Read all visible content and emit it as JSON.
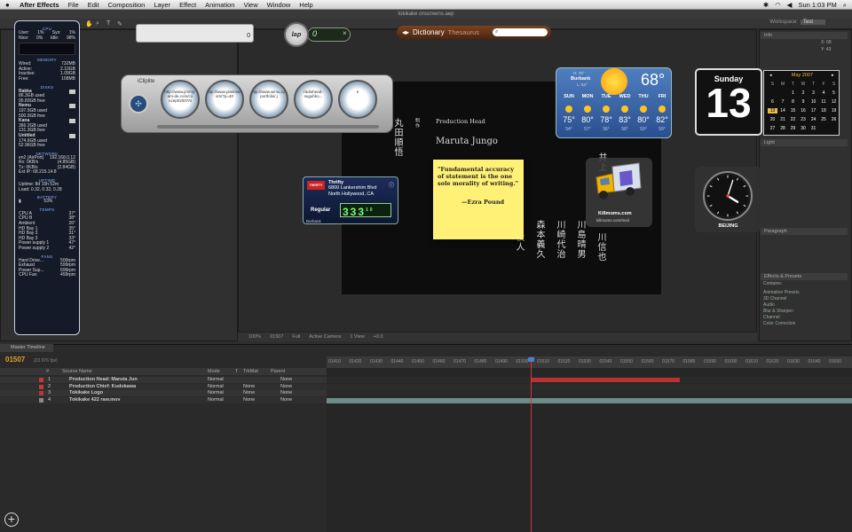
{
  "menubar": {
    "app": "After Effects",
    "items": [
      "File",
      "Edit",
      "Composition",
      "Layer",
      "Effect",
      "Animation",
      "View",
      "Window",
      "Help"
    ],
    "clock": "Sun 1:03 PM"
  },
  "window_title": "tokikake onscreens.aep",
  "workspace": {
    "label": "Workspace:",
    "value": "Test"
  },
  "istat": {
    "cpu_title": "CPU",
    "cpu": [
      [
        "User:",
        "1%",
        "Sys:",
        "1%"
      ],
      [
        "Nice:",
        "0%",
        "Idle:",
        "98%"
      ]
    ],
    "memory_title": "MEMORY",
    "memory": [
      [
        "Wired:",
        "732MB"
      ],
      [
        "Active:",
        "2.10GB"
      ],
      [
        "Inactive:",
        "1.09GB"
      ],
      [
        "Free:",
        "108MB"
      ]
    ],
    "disks_title": "DISKS",
    "disks": [
      {
        "name": "Rakka",
        "used": "86.3GB used",
        "free": "95.83GB free"
      },
      {
        "name": "Nemu",
        "used": "197.5GB used",
        "free": "500.9GB free"
      },
      {
        "name": "Kana",
        "used": "366.2GB used",
        "free": "131.3GB free"
      },
      {
        "name": "Untitled",
        "used": "174.6GB used",
        "free": "52.96GB free"
      }
    ],
    "network_title": "NETWORK",
    "network": [
      [
        "en2 (AirPort)",
        "192.168.0.12"
      ],
      [
        "Rx: 0KB/s",
        "(4.85GB)"
      ],
      [
        "Tx: 0KB/s",
        "(2.84GB)"
      ],
      [
        "Ext IP: 68.215.14.8",
        ""
      ]
    ],
    "uptime_title": "UPTIME",
    "uptime": "Uptime: 8d 15h 52m",
    "load": "Load: 0.32, 0.32, 0.28",
    "battery_title": "BATTERY",
    "battery": "53%",
    "temps_title": "TEMPS",
    "temps": [
      [
        "CPU A",
        "37°"
      ],
      [
        "CPU B",
        "38°"
      ],
      [
        "Ambient",
        "26°"
      ],
      [
        "HD Bay 1",
        "35°"
      ],
      [
        "HD Bay 3",
        "31°"
      ],
      [
        "HD Bay 3",
        "33°"
      ],
      [
        "Power supply 1",
        "47°"
      ],
      [
        "Power supply 2",
        "42°"
      ]
    ],
    "fans_title": "FANS",
    "fans": [
      [
        "Hard Drive...",
        "500rpm"
      ],
      [
        "Exhaust",
        "599rpm"
      ],
      [
        "Power Sup...",
        "699rpm"
      ],
      [
        "CPU Fan",
        "499rpm"
      ]
    ]
  },
  "search_widget": {
    "value": "0"
  },
  "lap_widget": {
    "label": "lap",
    "value": "0"
  },
  "dictionary": {
    "tab1": "Dictionary",
    "tab2": "Thesaurus",
    "placeholder": ""
  },
  "icliplite": {
    "title": "iCliplite",
    "clips": [
      "http://www.jimmy-am-de.com/co ncept/2007/0",
      "http://www.plasmamo.c om/?p=40",
      "http://www.wimu.com/s portfolio/.j",
      "radiohead-suguhko...",
      "e"
    ]
  },
  "thrifty": {
    "logo": "THRIFTY",
    "name": "Thrifty",
    "street": "6800 Lankershim Blvd",
    "city_state": "North Hollywood, CA",
    "grade": "Regular",
    "price": "333",
    "tenth": "10",
    "town": "Burbank"
  },
  "sticky": {
    "quote": "\"Fundamental accuracy of statement is the one sole morality of writing.\"",
    "author": "—Ezra Pound"
  },
  "killmoms": {
    "name": "Killmoms.com",
    "url": "killmoms.com/mail"
  },
  "weather": {
    "hilo": "H: 75°",
    "city": "Burbank",
    "lo": "L: 54°",
    "temp": "68°",
    "days": [
      {
        "d": "SUN",
        "hi": "75°",
        "lo": "54°"
      },
      {
        "d": "MON",
        "hi": "80°",
        "lo": "57°"
      },
      {
        "d": "TUE",
        "hi": "78°",
        "lo": "56°"
      },
      {
        "d": "WED",
        "hi": "83°",
        "lo": "58°"
      },
      {
        "d": "THU",
        "hi": "80°",
        "lo": "59°"
      },
      {
        "d": "FRI",
        "hi": "82°",
        "lo": "59°"
      }
    ]
  },
  "calendar": {
    "weekday": "Sunday",
    "date": "13"
  },
  "month_cal": {
    "title": "May 2007",
    "headers": [
      "S",
      "M",
      "T",
      "W",
      "T",
      "F",
      "S"
    ],
    "weeks": [
      [
        "",
        "",
        "1",
        "2",
        "3",
        "4",
        "5"
      ],
      [
        "6",
        "7",
        "8",
        "9",
        "10",
        "11",
        "12"
      ],
      [
        "13",
        "14",
        "15",
        "16",
        "17",
        "18",
        "19"
      ],
      [
        "20",
        "21",
        "22",
        "23",
        "24",
        "25",
        "26"
      ],
      [
        "27",
        "28",
        "29",
        "30",
        "31",
        "",
        ""
      ]
    ],
    "today": "13"
  },
  "clock": {
    "city": "BEIJING",
    "hours": "4",
    "minutes": "3"
  },
  "comp": {
    "production_head": "Production Head",
    "name": "Maruta Jungo",
    "vert_small": "制作",
    "vert_name": "丸田順悟",
    "col1": "森本義久",
    "col2": "川崎代治",
    "col3": "川島晴男",
    "col4": "川信也",
    "col5": "井上",
    "col6": "役人",
    "status": [
      "100%",
      "01507",
      "Full",
      "Active Camera",
      "1 View",
      "+0.0"
    ]
  },
  "right_panel": {
    "info": "Info",
    "x": "X: 68",
    "y": "Y: 43",
    "character": "Light",
    "paragraph": "Paragraph",
    "effects": "Effects & Presets",
    "contains": "Contains:",
    "presets": [
      "Animation Presets",
      "3D Channel",
      "Audio",
      "Blur & Sharpen",
      "Channel",
      "Color Correction"
    ]
  },
  "timeline": {
    "tab": "Master Timeline",
    "time": "01507",
    "fps": "(23.976 fps)",
    "headers": [
      "#",
      "Source Name",
      "Mode",
      "T",
      "TrkMat",
      "Parent"
    ],
    "layers": [
      {
        "n": "1",
        "name": "Production Head: Maruta Jun",
        "mode": "Normal",
        "trk": "",
        "parent": "None",
        "color": "#c23b3b"
      },
      {
        "n": "2",
        "name": "Production Chief: Kudokawa",
        "mode": "Normal",
        "trk": "None",
        "parent": "None",
        "color": "#c23b3b"
      },
      {
        "n": "3",
        "name": "Tokikake Logo",
        "mode": "Normal",
        "trk": "None",
        "parent": "None",
        "color": "#b53838"
      },
      {
        "n": "4",
        "name": "Tokikake 422 raw.mov",
        "mode": "Normal",
        "trk": "None",
        "parent": "None",
        "color": "#888888"
      }
    ],
    "ruler": [
      "01410",
      "01420",
      "01430",
      "01440",
      "01450",
      "01460",
      "01470",
      "01480",
      "01490",
      "01500",
      "01510",
      "01520",
      "01530",
      "01540",
      "01550",
      "01560",
      "01570",
      "01580",
      "01590",
      "01600",
      "01610",
      "01620",
      "01630",
      "01640",
      "01650"
    ]
  }
}
